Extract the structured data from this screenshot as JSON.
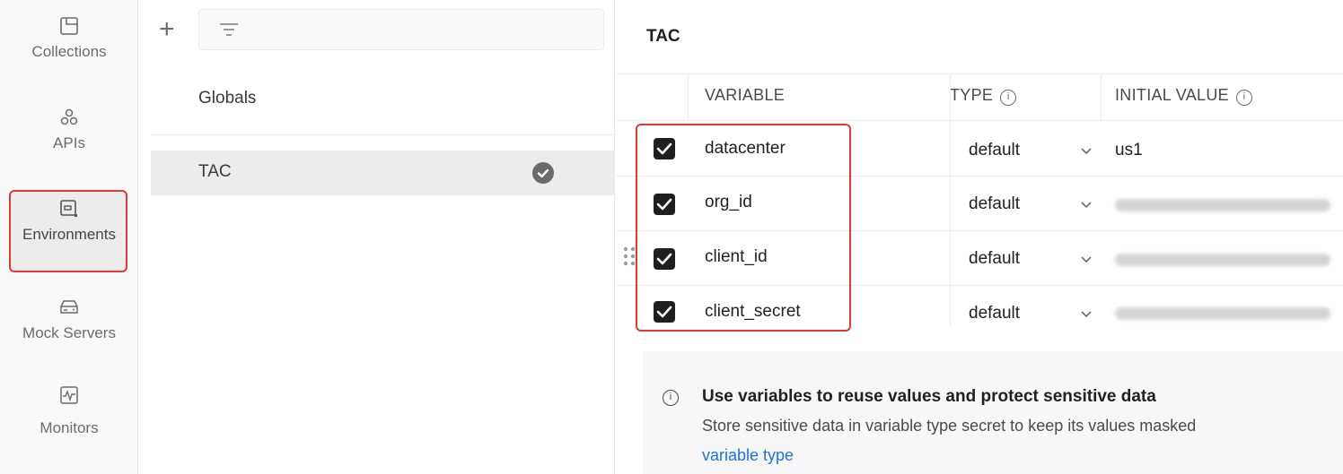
{
  "rail": {
    "items": [
      {
        "label": "Collections",
        "icon": "collections-icon"
      },
      {
        "label": "APIs",
        "icon": "apis-icon"
      },
      {
        "label": "Environments",
        "icon": "environments-icon"
      },
      {
        "label": "Mock Servers",
        "icon": "mock-servers-icon"
      },
      {
        "label": "Monitors",
        "icon": "monitors-icon"
      }
    ]
  },
  "envpanel": {
    "add_symbol": "+",
    "items": [
      {
        "label": "Globals"
      },
      {
        "label": "TAC"
      }
    ]
  },
  "content": {
    "title": "TAC",
    "columns": {
      "variable": "VARIABLE",
      "type": "TYPE",
      "initial_value": "INITIAL VALUE"
    },
    "rows": [
      {
        "variable": "datacenter",
        "type": "default",
        "initial_value": "us1"
      },
      {
        "variable": "org_id",
        "type": "default",
        "initial_value": ""
      },
      {
        "variable": "client_id",
        "type": "default",
        "initial_value": ""
      },
      {
        "variable": "client_secret",
        "type": "default",
        "initial_value": ""
      }
    ],
    "note": {
      "title": "Use variables to reuse values and protect sensitive data",
      "body": "Store sensitive data in variable type secret to keep its values masked",
      "link": "variable type"
    }
  },
  "colors": {
    "highlight_border": "#e53935",
    "link": "#1a73e8",
    "checkbox": "#1f1f1f"
  }
}
